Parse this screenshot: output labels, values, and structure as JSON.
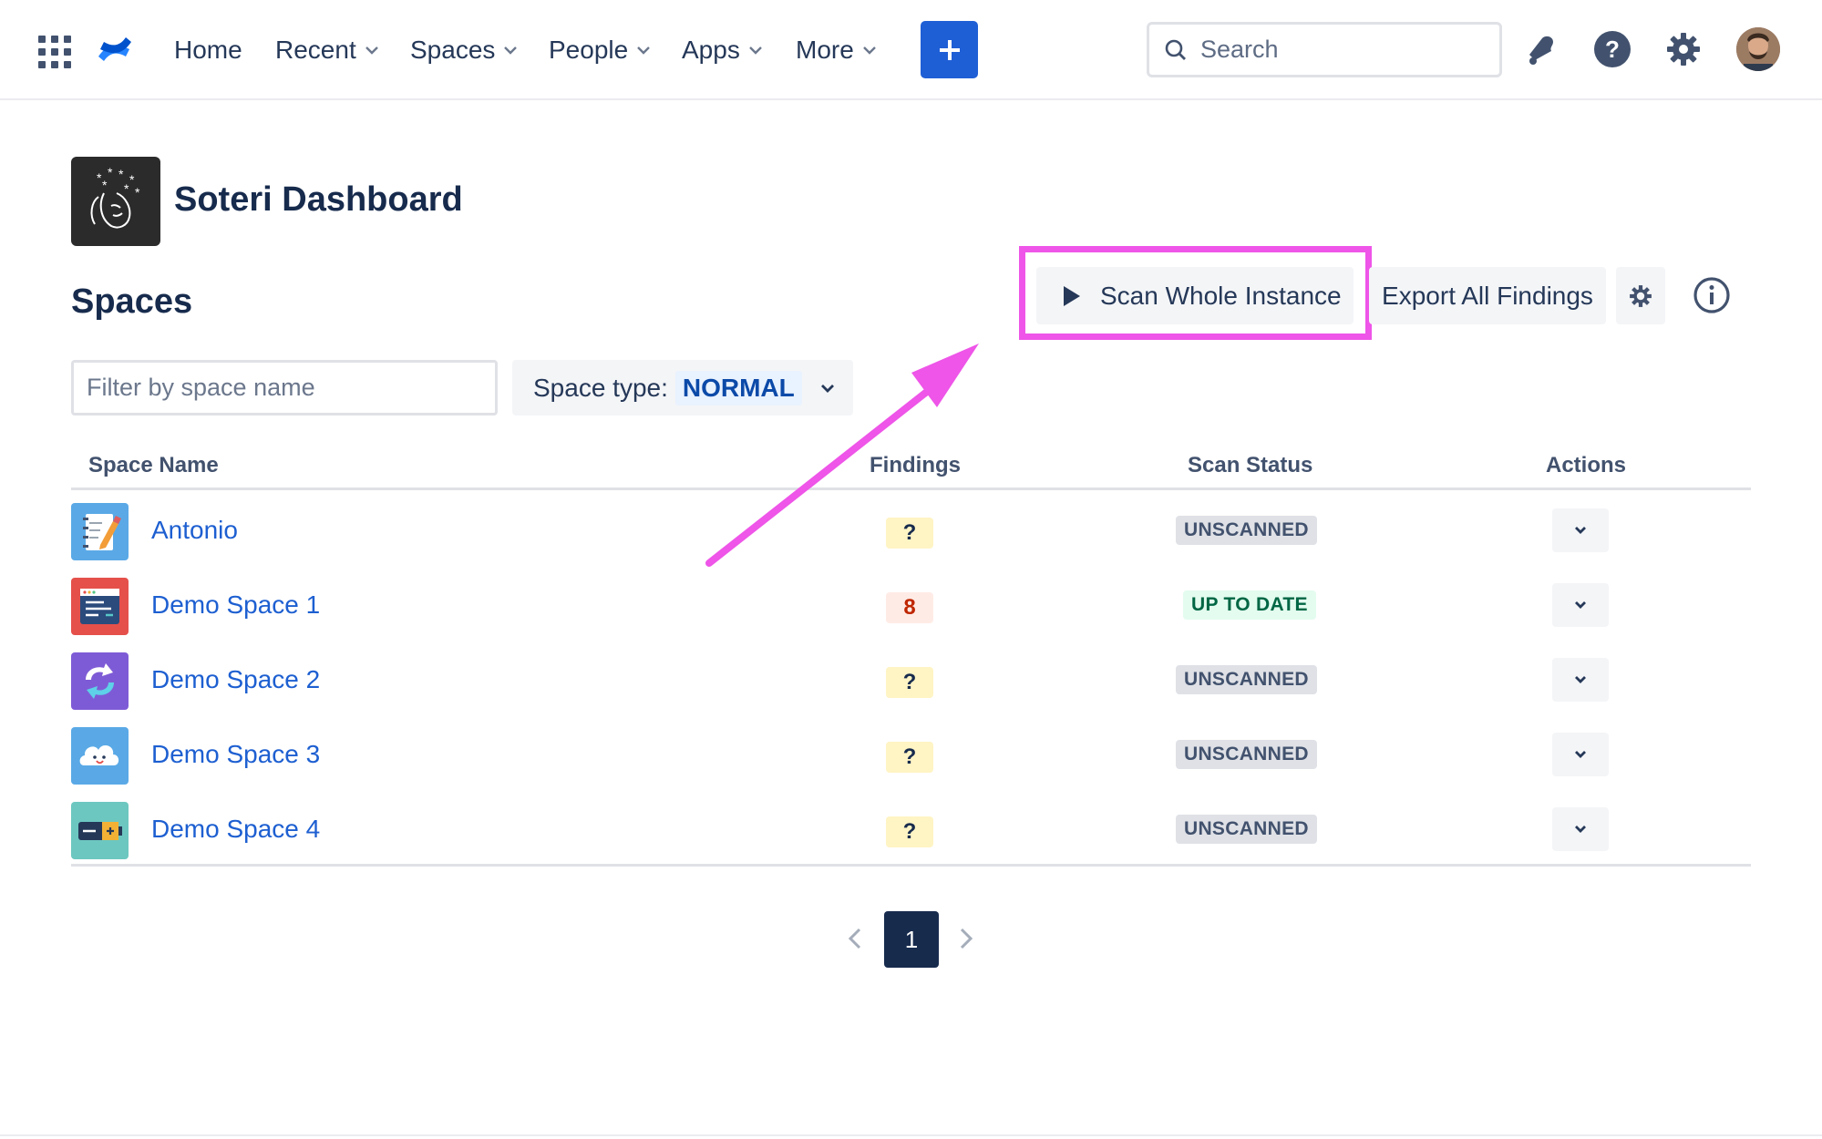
{
  "nav": {
    "items": [
      {
        "label": "Home",
        "has_menu": false
      },
      {
        "label": "Recent",
        "has_menu": true
      },
      {
        "label": "Spaces",
        "has_menu": true
      },
      {
        "label": "People",
        "has_menu": true
      },
      {
        "label": "Apps",
        "has_menu": true
      },
      {
        "label": "More",
        "has_menu": true
      }
    ],
    "search_placeholder": "Search",
    "create_icon": "plus-icon",
    "icons": [
      "notification-icon",
      "help-icon",
      "settings-icon"
    ]
  },
  "page": {
    "title": "Soteri Dashboard",
    "section_title": "Spaces"
  },
  "actions": {
    "scan_label": "Scan Whole Instance",
    "export_label": "Export All Findings"
  },
  "filters": {
    "name_placeholder": "Filter by space name",
    "space_type_label": "Space type:",
    "space_type_value": "NORMAL"
  },
  "table": {
    "headers": {
      "name": "Space Name",
      "findings": "Findings",
      "status": "Scan Status",
      "actions": "Actions"
    },
    "rows": [
      {
        "name": "Antonio",
        "findings": "?",
        "status": "UNSCANNED",
        "icon": "notepad-pencil-icon"
      },
      {
        "name": "Demo Space 1",
        "findings": "8",
        "status": "UP TO DATE",
        "icon": "browser-window-icon"
      },
      {
        "name": "Demo Space 2",
        "findings": "?",
        "status": "UNSCANNED",
        "icon": "refresh-arrows-icon"
      },
      {
        "name": "Demo Space 3",
        "findings": "?",
        "status": "UNSCANNED",
        "icon": "cloud-face-icon"
      },
      {
        "name": "Demo Space 4",
        "findings": "?",
        "status": "UNSCANNED",
        "icon": "battery-icon"
      }
    ]
  },
  "pagination": {
    "current_page": "1"
  },
  "colors": {
    "primary": "#1f5fd6",
    "highlight": "#ee55e8",
    "link": "#1d5fd1",
    "text": "#172b4d"
  }
}
